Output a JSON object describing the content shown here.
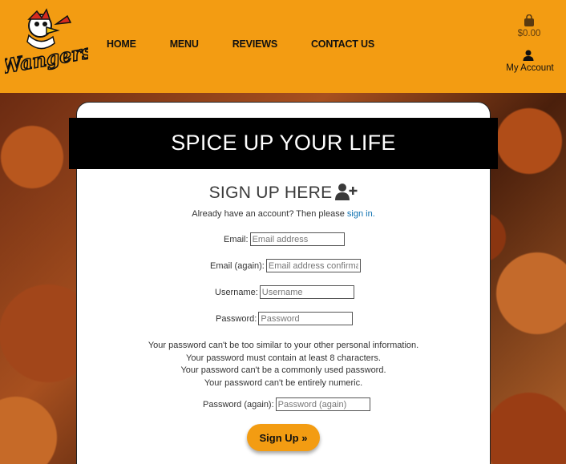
{
  "header": {
    "logo_text": "Wangers",
    "nav": [
      "HOME",
      "MENU",
      "REVIEWS",
      "CONTACT US"
    ],
    "bag_total": "$0.00",
    "account_label": "My Account"
  },
  "banner": {
    "title": "SPICE UP YOUR LIFE"
  },
  "signup": {
    "title": "SIGN UP HERE",
    "already_prefix": "Already have an account? Then please ",
    "signin_link": "sign in.",
    "fields": [
      {
        "label": "Email:",
        "placeholder": "Email address"
      },
      {
        "label": "Email (again):",
        "placeholder": "Email address confirmation"
      },
      {
        "label": "Username:",
        "placeholder": "Username"
      },
      {
        "label": "Password:",
        "placeholder": "Password"
      }
    ],
    "help": [
      "Your password can't be too similar to your other personal information.",
      "Your password must contain at least 8 characters.",
      "Your password can't be a commonly used password.",
      "Your password can't be entirely numeric."
    ],
    "password_again": {
      "label": "Password (again):",
      "placeholder": "Password (again)"
    },
    "submit_label": "Sign Up »"
  },
  "colors": {
    "brand": "#f39c12",
    "banner": "#000000",
    "link": "#0a6fb0"
  }
}
